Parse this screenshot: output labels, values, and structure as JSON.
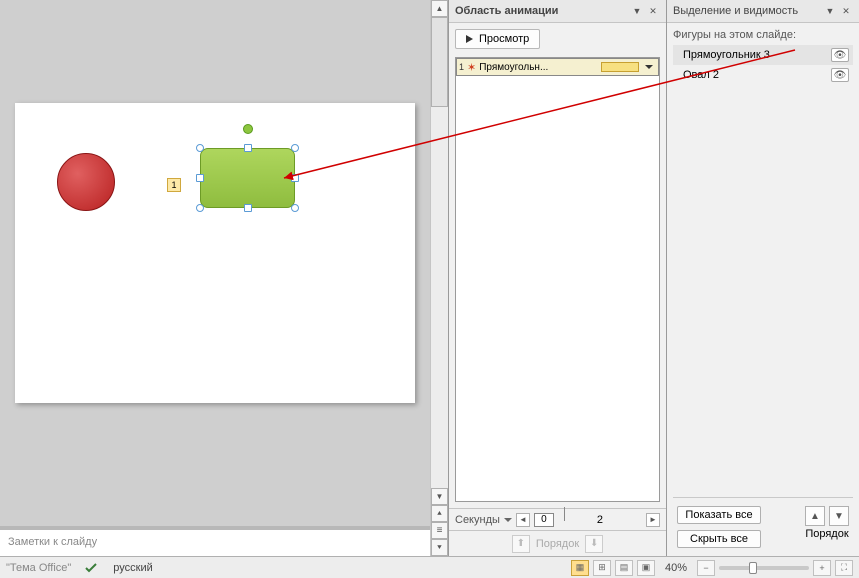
{
  "anim_pane": {
    "title": "Область анимации",
    "play": "Просмотр",
    "item": {
      "index": "1",
      "label": "Прямоугольн..."
    },
    "timeline_label": "Секунды",
    "timeline_pos": "0",
    "timeline_mark": "2",
    "order_label": "Порядок"
  },
  "sel_pane": {
    "title": "Выделение и видимость",
    "hint": "Фигуры на этом слайде:",
    "items": [
      {
        "name": "Прямоугольник 3"
      },
      {
        "name": "Овал 2"
      }
    ],
    "show_all": "Показать все",
    "hide_all": "Скрыть все",
    "order_label": "Порядок"
  },
  "slide": {
    "anim_tag": "1"
  },
  "notes": {
    "placeholder": "Заметки к слайду"
  },
  "status": {
    "theme": "\"Тема Office\"",
    "lang": "русский",
    "zoom": "40%"
  }
}
